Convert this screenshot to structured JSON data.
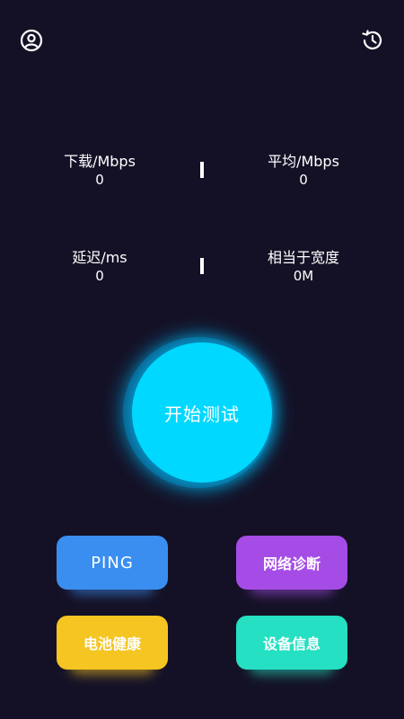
{
  "header": {
    "profile_icon": "user-circle-icon",
    "history_icon": "history-clock-icon"
  },
  "stats": {
    "download": {
      "label": "下载/Mbps",
      "value": "0"
    },
    "average": {
      "label": "平均/Mbps",
      "value": "0"
    },
    "latency": {
      "label": "延迟/ms",
      "value": "0"
    },
    "bandwidth": {
      "label": "相当于宽度",
      "value": "0M"
    }
  },
  "start_button": {
    "label": "开始测试"
  },
  "actions": {
    "ping": {
      "label": "PING",
      "color": "#3a8ef0"
    },
    "network_diagnosis": {
      "label": "网络诊断",
      "color": "#a64ce6"
    },
    "battery_health": {
      "label": "电池健康",
      "color": "#f5c522"
    },
    "device_info": {
      "label": "设备信息",
      "color": "#25e0c2"
    }
  },
  "colors": {
    "background": "#141126",
    "start_accent": "#00d8ff"
  }
}
